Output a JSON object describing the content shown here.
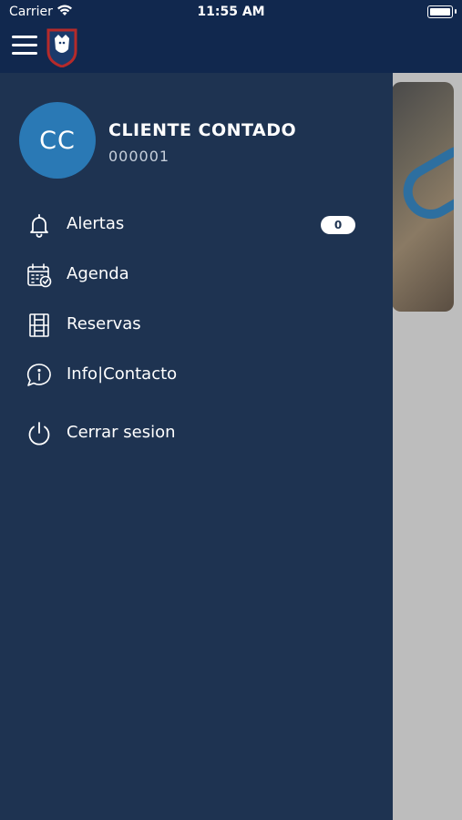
{
  "status_bar": {
    "carrier": "Carrier",
    "time": "11:55 AM"
  },
  "colors": {
    "topbar": "#11284e",
    "drawer": "#1e3351",
    "avatar": "#2a79b5"
  },
  "user": {
    "initials": "CC",
    "name": "CLIENTE CONTADO",
    "code": "000001"
  },
  "menu": [
    {
      "label": "Alertas",
      "icon": "bell-icon",
      "badge": "0"
    },
    {
      "label": "Agenda",
      "icon": "calendar-check-icon"
    },
    {
      "label": "Reservas",
      "icon": "court-grid-icon"
    },
    {
      "label": "Info|Contacto",
      "icon": "info-chat-icon"
    },
    {
      "label": "Cerrar sesion",
      "icon": "power-icon"
    }
  ]
}
